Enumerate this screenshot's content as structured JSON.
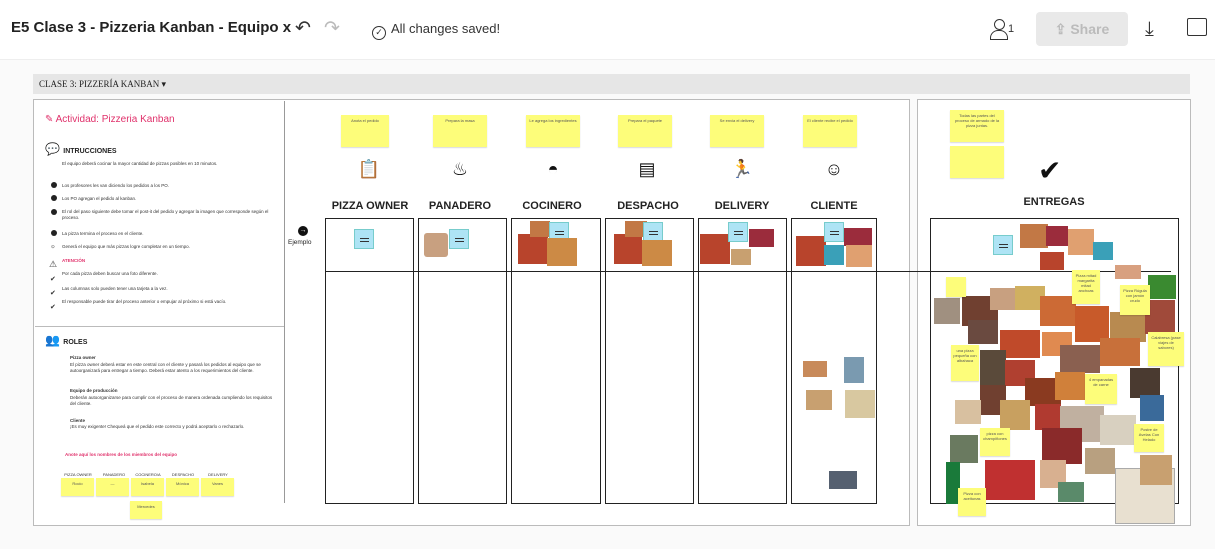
{
  "header": {
    "title": "E5 Clase 3 - Pizzeria Kanban - Equipo x",
    "saved": "All changes saved!",
    "users_count": "1",
    "share_label": "Share"
  },
  "section": {
    "label": "CLASE 3: PIZZERÍA KANBAN"
  },
  "left": {
    "activity_title": "Actividad: Pizzeria Kanban",
    "instructions_title": "INTRUCCIONES",
    "intro": "El equipo deberá cocinar la mayor cantidad de pizzas posibles en 10 minutos.",
    "steps": [
      "Los profesores les van diciendo los pedidos a los PO.",
      "Los PO agregan el pedido al kanban.",
      "El rol del paso siguiente debe tomar el post-it del pedido y agregar la imagen que corresponde según el proceso.",
      "La pizza termina el proceso en el cliente.",
      "Generá el equipo que más pizzas logre completar en un tiempo."
    ],
    "attention_title": "ATENCIÓN",
    "attention": [
      "Por cada pizza deben buscar una foto diferente.",
      "Las columnas solo pueden tener una tarjeta a la vez.",
      "El responsable puede tirar del proceso anterior o empujar al próximo si está vacío."
    ],
    "roles_title": "ROLES",
    "roles": [
      {
        "name": "Pizza owner",
        "desc": "El pizza owner deberá estar en este central con el cliente y pasará los pedidos al equipo que se autoorganizará para entregar a tiempo. Deberá estar atento a los requerimientos del cliente."
      },
      {
        "name": "Equipo de producción",
        "desc": "Deberán autoorganizarse para cumplir con el proceso de manera ordenada cumpliendo los requisitos del cliente."
      },
      {
        "name": "Cliente",
        "desc": "¡Es muy exigente! Chequeá que el pedido este correcto y podrá aceptarlo o rechazarlo."
      }
    ],
    "names_note": "Anote aquí los nombres de los miembros del equipo",
    "team_roles": [
      "PIZZA OWNER",
      "PANADERO",
      "COCINERO/A",
      "DESPACHO",
      "DELIVERY"
    ],
    "team_names": [
      "Rocio",
      "—",
      "Isabela",
      "Mónica",
      "Vanes",
      "Mercedes"
    ]
  },
  "board": {
    "ejemplo": "Ejemplo",
    "columns": [
      {
        "title": "PIZZA OWNER",
        "note": "Anota el pedido",
        "icon": "clipboard-icon"
      },
      {
        "title": "PANADERO",
        "note": "Prepara la masa",
        "icon": "chef-hat-icon"
      },
      {
        "title": "COCINERO",
        "note": "Le agrega los ingredientes",
        "icon": "cloche-icon"
      },
      {
        "title": "DESPACHO",
        "note": "Prepara el paquete",
        "icon": "pizza-box-icon"
      },
      {
        "title": "DELIVERY",
        "note": "Se envia el delivery",
        "icon": "delivery-icon"
      },
      {
        "title": "CLIENTE",
        "note": "El cliente recibe el pedido",
        "icon": "smile-icon"
      }
    ],
    "deliveries": {
      "title": "ENTREGAS",
      "note": "Todas las partes del proceso de armado de la pizza juntas.",
      "scattered_notes": [
        "Pizza mitad margarita mitad anchoas",
        "Pizza Rúgula con jamón crudo",
        "una pizza pequeña con albahaca",
        "4 empanadas de carne",
        "pizza con champiñones",
        "Calabresa (pase viajes de sabores)",
        "Postre de Avelas Con Helado",
        "Pizza con aceitunas"
      ]
    },
    "colors": {
      "sticky": "#fdfd7a",
      "blue_note": "#aee4f5",
      "accent": "#e0316b"
    }
  }
}
